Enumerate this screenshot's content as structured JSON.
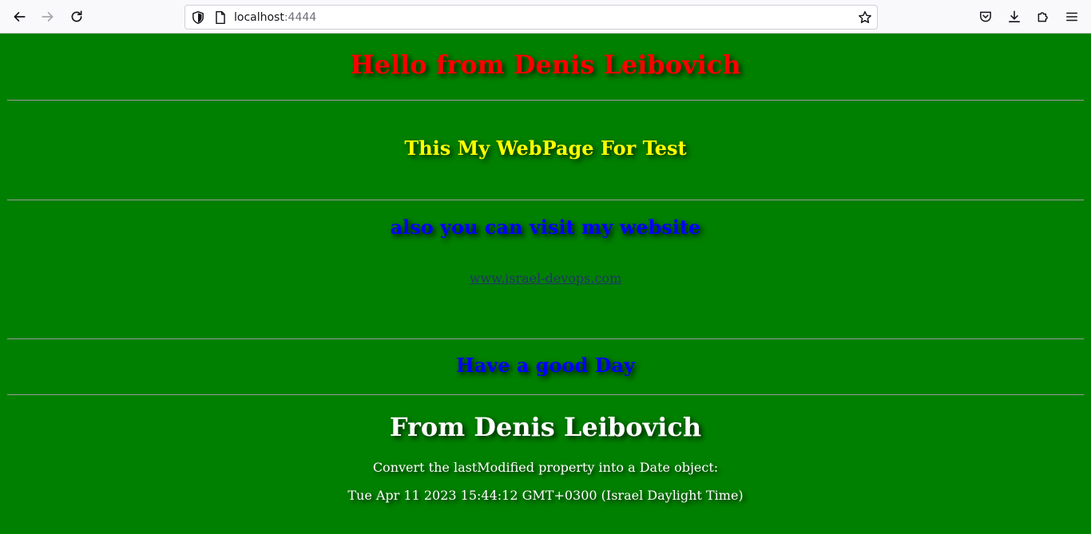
{
  "browser": {
    "url_host": "localhost",
    "url_port": ":4444",
    "icons": {
      "back": "arrow-left-icon",
      "forward": "arrow-right-icon",
      "reload": "reload-icon",
      "shield": "shield-icon",
      "page": "page-icon",
      "bookmark": "star-icon",
      "pocket": "pocket-icon",
      "downloads": "download-icon",
      "extensions": "puzzle-icon",
      "menu": "hamburger-menu-icon"
    }
  },
  "page": {
    "title": "Hello from Denis Leibovich",
    "subtitle": "This My WebPage For Test",
    "visit_heading": "also you can visit my website",
    "website_link": "www.israel-devops.com",
    "good_day": "Have a good Day",
    "from_heading": "From Denis Leibovich",
    "convert_text": "Convert the lastModified property into a Date object:",
    "modified_date": "Tue Apr 11 2023 15:44:12 GMT+0300 (Israel Daylight Time)"
  },
  "colors": {
    "background": "#008000",
    "title": "#ff0000",
    "subtitle": "#ffff00",
    "blue_text": "#0000ff",
    "white_text": "#ffffff"
  }
}
